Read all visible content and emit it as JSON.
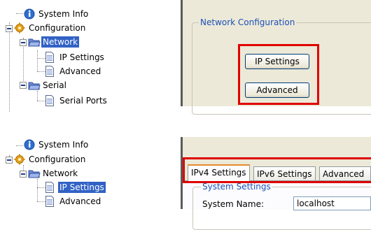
{
  "tree_top": {
    "items": [
      {
        "label": "System Info"
      },
      {
        "label": "Configuration"
      },
      {
        "label": "Network"
      },
      {
        "label": "IP Settings"
      },
      {
        "label": "Advanced"
      },
      {
        "label": "Serial"
      },
      {
        "label": "Serial Ports"
      }
    ],
    "selected": "Network"
  },
  "panel_top": {
    "group_title": "Network Configuration",
    "buttons": [
      {
        "label": "IP Settings"
      },
      {
        "label": "Advanced"
      }
    ]
  },
  "tree_bottom": {
    "items": [
      {
        "label": "System Info"
      },
      {
        "label": "Configuration"
      },
      {
        "label": "Network"
      },
      {
        "label": "IP Settings"
      },
      {
        "label": "Advanced"
      }
    ],
    "selected": "IP Settings"
  },
  "panel_bottom": {
    "tabs": [
      {
        "label": "IPv4 Settings"
      },
      {
        "label": "IPv6 Settings"
      },
      {
        "label": "Advanced"
      }
    ],
    "active_tab": "IPv4 Settings",
    "group_title": "System Settings",
    "field_label": "System Name:",
    "field_value": "localhost"
  },
  "colors": {
    "highlight": "#e00000",
    "selection": "#3162c5",
    "group_title": "#1d4fb7",
    "panel_bg": "#ece9d8"
  },
  "icons": {
    "system_info": "info-icon",
    "configuration": "gear-icon",
    "network": "folder-open-icon",
    "page": "page-icon"
  }
}
